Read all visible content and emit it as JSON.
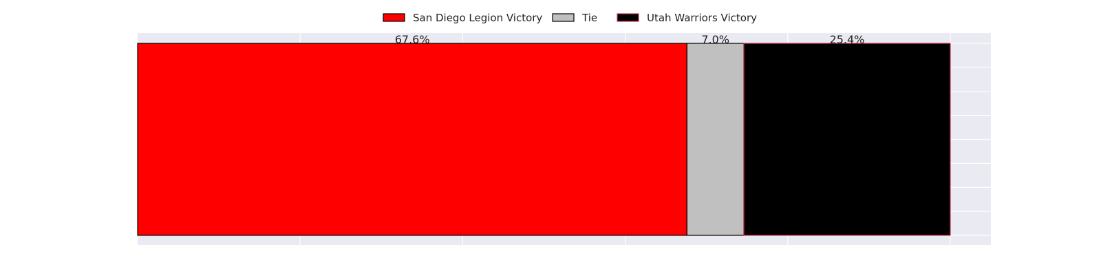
{
  "chart_data": {
    "type": "bar",
    "orientation": "horizontal",
    "stacked": true,
    "categories": [
      ""
    ],
    "series": [
      {
        "name": "San Diego Legion Victory",
        "values": [
          67.6
        ],
        "label": "67.6%",
        "color": "#ff0000",
        "edge_color": "#000000"
      },
      {
        "name": "Tie",
        "values": [
          7.0
        ],
        "label": "7.0%",
        "color": "#c0c0c0",
        "edge_color": "#000000"
      },
      {
        "name": "Utah Warriors Victory",
        "values": [
          25.4
        ],
        "label": "25.4%",
        "color": "#000000",
        "edge_color": "#c8304e"
      }
    ],
    "xlim": [
      0,
      105
    ],
    "grid": true,
    "legend_position": "top-center",
    "background_color": "#eaeaf2",
    "grid_color": "#ffffff"
  }
}
